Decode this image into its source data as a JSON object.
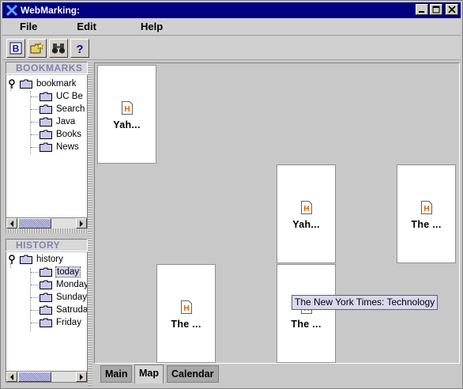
{
  "window": {
    "title": "WebMarking:"
  },
  "menu": {
    "file": "File",
    "edit": "Edit",
    "help": "Help"
  },
  "toolbar": [
    {
      "icon": "bookmark-b-icon"
    },
    {
      "icon": "open-folder-icon"
    },
    {
      "icon": "binoculars-icon"
    },
    {
      "icon": "help-question-icon"
    }
  ],
  "bookmarks": {
    "header": "BOOKMARKS",
    "root": "bookmark",
    "items": [
      "UC Be",
      "Search",
      "Java",
      "Books",
      "News"
    ]
  },
  "history": {
    "header": "HISTORY",
    "root": "history",
    "items": [
      "today",
      "Monday",
      "Sunday",
      "Satruday",
      "Friday"
    ],
    "selected_index": 0
  },
  "cards": [
    {
      "label": "Yah..."
    },
    {
      "label": "Yah..."
    },
    {
      "label": "The ..."
    },
    {
      "label": "The ..."
    },
    {
      "label": "The ..."
    }
  ],
  "tooltip": "The New York Times: Technology",
  "tabs": [
    {
      "label": "Main"
    },
    {
      "label": "Map",
      "active": true
    },
    {
      "label": "Calendar"
    }
  ],
  "colors": {
    "titlebar": "#000080",
    "html-icon": "#e06000",
    "selection": "#d8d8f0"
  }
}
